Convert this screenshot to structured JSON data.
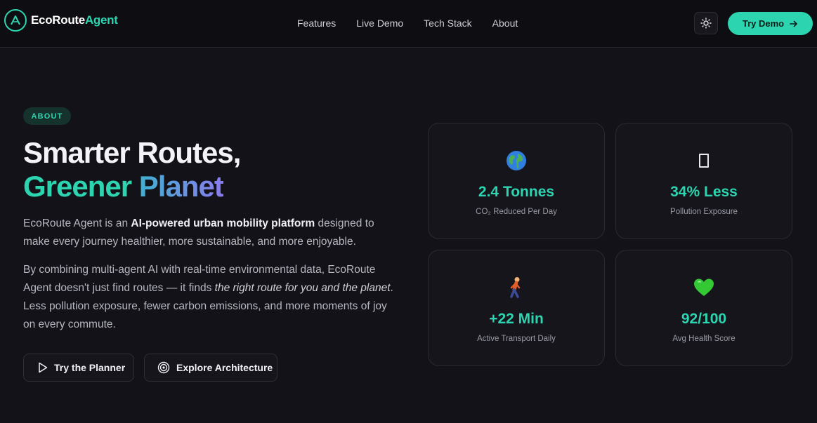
{
  "header": {
    "brand_part1": "EcoRoute",
    "brand_part2": "Agent",
    "nav": [
      "Features",
      "Live Demo",
      "Tech Stack",
      "About"
    ],
    "theme_toggle_icon": "sun-icon",
    "try_demo_label": "Try Demo"
  },
  "hero": {
    "badge": "ABOUT",
    "title_line1": "Smarter Routes,",
    "title_line2a": "Greener",
    "title_line2b": "Planet",
    "p1_pre": "EcoRoute Agent is an ",
    "p1_bold": "AI-powered urban mobility platform",
    "p1_post": " designed to make every journey healthier, more sustainable, and more enjoyable.",
    "p2_pre": "By combining multi-agent AI with real-time environmental data, EcoRoute Agent doesn't just find routes — it finds ",
    "p2_italic": "the right route for you and the planet",
    "p2_post": ". Less pollution exposure, fewer carbon emissions, and more moments of joy on every commute.",
    "btn_planner": "Try the Planner",
    "btn_architecture": "Explore Architecture"
  },
  "stats": [
    {
      "icon": "globe-icon",
      "value": "2.4 Tonnes",
      "label": "CO₂ Reduced Per Day"
    },
    {
      "icon": "missing-glyph-icon",
      "value": "34% Less",
      "label": "Pollution Exposure"
    },
    {
      "icon": "walking-person-icon",
      "value": "+22 Min",
      "label": "Active Transport Daily"
    },
    {
      "icon": "green-heart-icon",
      "value": "92/100",
      "label": "Avg Health Score"
    }
  ],
  "colors": {
    "accent": "#2dd4b0",
    "background": "#121218",
    "gradient_start": "#3fb0d0",
    "gradient_end": "#8b7cf0"
  }
}
